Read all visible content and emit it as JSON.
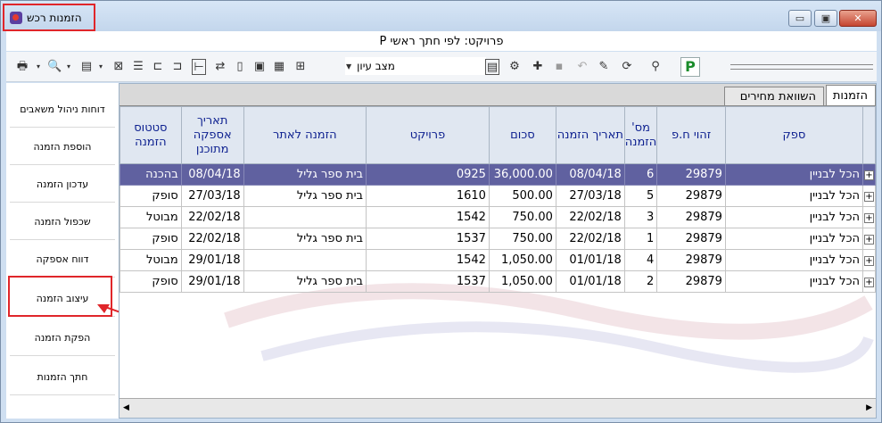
{
  "window": {
    "title": "הזמנות רכש",
    "subtitle": "פרויקט: לפי חתך ראשי  P",
    "controls": {
      "minimize": "▭",
      "maximize": "▣",
      "close": "✕"
    }
  },
  "toolbar": {
    "view_mode": "מצב עיון",
    "p_label": "P"
  },
  "sidebar": {
    "items": [
      {
        "label": "דוחות ניהול משאבים"
      },
      {
        "label": "הוספת הזמנה"
      },
      {
        "label": "עדכון הזמנה"
      },
      {
        "label": "שכפול הזמנה"
      },
      {
        "label": "דווח אספקה"
      },
      {
        "label": "עיצוב הזמנה"
      },
      {
        "label": "הפקת הזמנה"
      },
      {
        "label": "חתך הזמנות"
      }
    ]
  },
  "tabs": [
    {
      "label": "הזמנות"
    },
    {
      "label": "השוואת מחירים"
    }
  ],
  "table": {
    "headers": {
      "supplier": "ספק",
      "supplier_id": "זהוי ח.פ",
      "order_no": "מס' הזמנה",
      "order_date": "תאריך הזמנה",
      "amount": "סכום",
      "project": "פרויקט",
      "order_for": "הזמנה לאתר",
      "planned_date": "תאריך אספקה מתוכנן",
      "status": "סטטוס הזמנה"
    },
    "rows": [
      {
        "supplier": "הכל לבניין",
        "supplier_id": "29879",
        "order_no": "6",
        "order_date": "08/04/18",
        "amount": "36,000.00",
        "project": "0925",
        "order_for": "בית ספר גליל",
        "planned_date": "08/04/18",
        "status": "בהכנה",
        "selected": true
      },
      {
        "supplier": "הכל לבניין",
        "supplier_id": "29879",
        "order_no": "5",
        "order_date": "27/03/18",
        "amount": "500.00",
        "project": "1610",
        "order_for": "בית ספר גליל",
        "planned_date": "27/03/18",
        "status": "סופק",
        "selected": false
      },
      {
        "supplier": "הכל לבניין",
        "supplier_id": "29879",
        "order_no": "3",
        "order_date": "22/02/18",
        "amount": "750.00",
        "project": "1542",
        "order_for": "",
        "planned_date": "22/02/18",
        "status": "מבוטל",
        "selected": false
      },
      {
        "supplier": "הכל לבניין",
        "supplier_id": "29879",
        "order_no": "1",
        "order_date": "22/02/18",
        "amount": "750.00",
        "project": "1537",
        "order_for": "בית ספר גליל",
        "planned_date": "22/02/18",
        "status": "סופק",
        "selected": false
      },
      {
        "supplier": "הכל לבניין",
        "supplier_id": "29879",
        "order_no": "4",
        "order_date": "01/01/18",
        "amount": "1,050.00",
        "project": "1542",
        "order_for": "",
        "planned_date": "29/01/18",
        "status": "מבוטל",
        "selected": false
      },
      {
        "supplier": "הכל לבניין",
        "supplier_id": "29879",
        "order_no": "2",
        "order_date": "01/01/18",
        "amount": "1,050.00",
        "project": "1537",
        "order_for": "בית ספר גליל",
        "planned_date": "29/01/18",
        "status": "סופק",
        "selected": false
      }
    ]
  },
  "colors": {
    "selected_row": "#6061a0",
    "highlight_red": "#e0262a",
    "header_text": "#0c1f8f"
  }
}
